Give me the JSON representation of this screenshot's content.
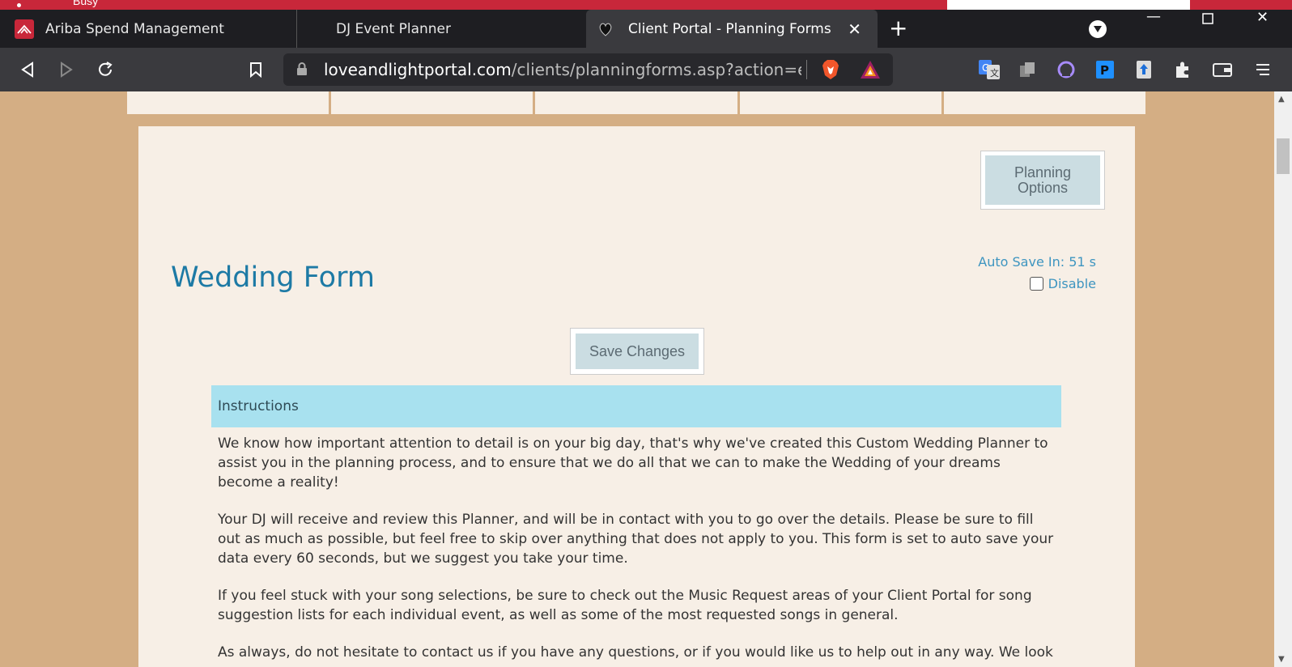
{
  "os": {
    "busy_label": "Busy"
  },
  "browser": {
    "tabs": [
      {
        "label": "Ariba Spend Management"
      },
      {
        "label": "DJ Event Planner"
      },
      {
        "label": "Client Portal - Planning Forms"
      }
    ],
    "url": {
      "host": "loveandlightportal.com",
      "path": "/clients/planningforms.asp?action=edi..."
    },
    "icons": [
      "back-icon",
      "forward-icon",
      "reload-icon",
      "bookmark-icon",
      "lock-icon",
      "brave-shield-icon",
      "brave-rewards-icon",
      "translate-icon",
      "copy-icon",
      "circle-extension-icon",
      "p-extension-icon",
      "upload-extension-icon",
      "extensions-icon",
      "wallet-icon",
      "menu-icon"
    ]
  },
  "page": {
    "planning_options_label": "Planning Options",
    "title": "Wedding Form",
    "autosave_label": "Auto Save In: 51 s",
    "disable_label": "Disable",
    "save_label": "Save Changes",
    "instructions_heading": "Instructions",
    "paragraphs": [
      "We know how important attention to detail is on your big day, that's why we've created this Custom Wedding Planner to assist you in the planning process, and to ensure that we do all that we can to make the Wedding of your dreams become a reality!",
      "Your DJ will receive and review this Planner, and will be in contact with you to go over the details. Please be sure to fill out as much as possible, but feel free to skip over anything that does not apply to you. This form is set to auto save your data every 60 seconds, but we suggest you take your time.",
      "If you feel stuck with your song selections, be sure to check out the Music Request areas of your Client Portal for song suggestion lists for each individual event, as well as some of the most requested songs in general.",
      "As always, do not hesitate to contact us if you have any questions, or if you would like us to help out in any way. We look"
    ]
  },
  "colors": {
    "page_bg": "#d4ae84",
    "card_bg": "#f7efe6",
    "title": "#1d7aa5",
    "instructions_bg": "#a8e1ef",
    "button_bg": "#cbdde2"
  }
}
